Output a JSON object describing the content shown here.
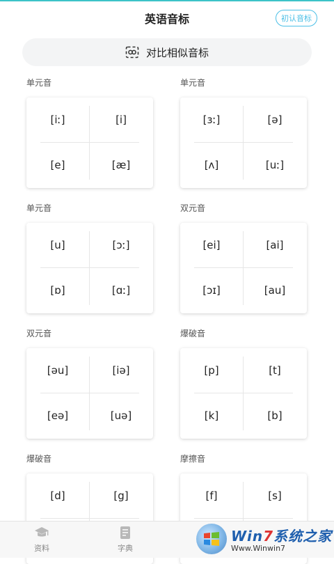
{
  "header": {
    "title": "英语音标",
    "intro_button": "初认音标"
  },
  "compare_button": {
    "label": "对比相似音标",
    "icon": "compare-icon"
  },
  "sections": [
    {
      "label": "单元音",
      "symbols": [
        "[iː]",
        "[i]",
        "[e]",
        "[æ]"
      ]
    },
    {
      "label": "单元音",
      "symbols": [
        "[ɜː]",
        "[ə]",
        "[ʌ]",
        "[uː]"
      ]
    },
    {
      "label": "单元音",
      "symbols": [
        "[u]",
        "[ɔː]",
        "[ɒ]",
        "[ɑː]"
      ]
    },
    {
      "label": "双元音",
      "symbols": [
        "[ei]",
        "[ai]",
        "[ɔɪ]",
        "[au]"
      ]
    },
    {
      "label": "双元音",
      "symbols": [
        "[əu]",
        "[iə]",
        "[eə]",
        "[uə]"
      ]
    },
    {
      "label": "爆破音",
      "symbols": [
        "[p]",
        "[t]",
        "[k]",
        "[b]"
      ]
    },
    {
      "label": "爆破音",
      "symbols": [
        "[d]",
        "[g]",
        "",
        ""
      ]
    },
    {
      "label": "摩擦音",
      "symbols": [
        "[f]",
        "[s]",
        "",
        ""
      ]
    }
  ],
  "bottom_nav": [
    {
      "label": "资料",
      "icon": "graduation-cap-icon"
    },
    {
      "label": "字典",
      "icon": "book-icon"
    }
  ],
  "watermark": {
    "brand_prefix": "Win",
    "brand_num": "7",
    "brand_suffix": "系统之家",
    "url": "Www.Winwin7"
  },
  "colors": {
    "accent": "#4bbfe6",
    "top_line": "#3cc3c8"
  }
}
